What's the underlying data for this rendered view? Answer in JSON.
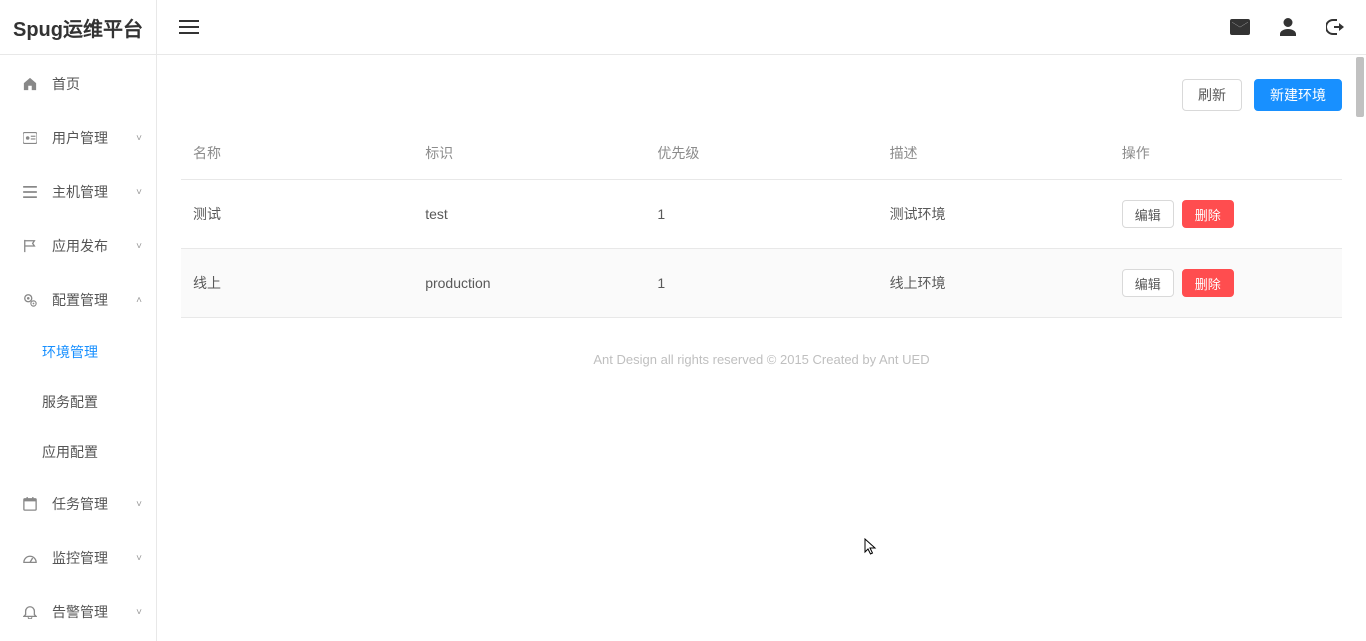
{
  "logo": "Spug运维平台",
  "sidebar": {
    "items": [
      {
        "label": "首页",
        "kind": "item",
        "icon": "home"
      },
      {
        "label": "用户管理",
        "kind": "submenu",
        "icon": "badge",
        "expanded": false
      },
      {
        "label": "主机管理",
        "kind": "submenu",
        "icon": "list",
        "expanded": false
      },
      {
        "label": "应用发布",
        "kind": "submenu",
        "icon": "flag",
        "expanded": false
      },
      {
        "label": "配置管理",
        "kind": "submenu",
        "icon": "gears",
        "expanded": true,
        "children": [
          {
            "label": "环境管理",
            "active": true
          },
          {
            "label": "服务配置",
            "active": false
          },
          {
            "label": "应用配置",
            "active": false
          }
        ]
      },
      {
        "label": "任务管理",
        "kind": "submenu",
        "icon": "calendar",
        "expanded": false
      },
      {
        "label": "监控管理",
        "kind": "submenu",
        "icon": "dashboard",
        "expanded": false
      },
      {
        "label": "告警管理",
        "kind": "submenu",
        "icon": "bell",
        "expanded": false
      }
    ]
  },
  "header": {
    "icons": [
      "mail",
      "user",
      "logout"
    ]
  },
  "actions": {
    "refresh": "刷新",
    "create": "新建环境"
  },
  "table": {
    "columns": [
      "名称",
      "标识",
      "优先级",
      "描述",
      "操作"
    ],
    "rows": [
      {
        "name": "测试",
        "key": "test",
        "priority": "1",
        "desc": "测试环境"
      },
      {
        "name": "线上",
        "key": "production",
        "priority": "1",
        "desc": "线上环境"
      }
    ],
    "row_actions": {
      "edit": "编辑",
      "delete": "删除"
    }
  },
  "footer": "Ant Design all rights reserved © 2015 Created by Ant UED"
}
